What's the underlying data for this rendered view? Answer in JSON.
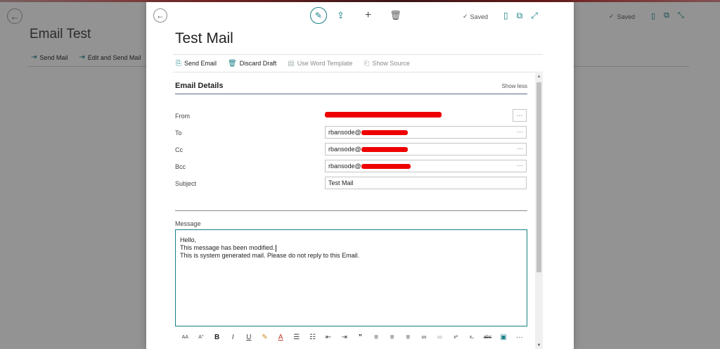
{
  "background": {
    "title": "Email Test",
    "actions": [
      {
        "icon": "send-icon",
        "label": "Send Mail"
      },
      {
        "icon": "send-icon",
        "label": "Edit and Send Mail"
      }
    ],
    "status": "Saved"
  },
  "dialog": {
    "title": "Test Mail",
    "status": "Saved",
    "top_icons": [
      "edit-icon",
      "share-icon",
      "add-icon",
      "delete-icon"
    ],
    "right_icons": [
      "bookmark-icon",
      "open-in-new-icon",
      "expand-icon"
    ],
    "actions": [
      {
        "icon": "send-email-icon",
        "label": "Send Email",
        "enabled": true
      },
      {
        "icon": "trash-icon",
        "label": "Discard Draft",
        "enabled": true
      },
      {
        "icon": "word-template-icon",
        "label": "Use Word Template",
        "enabled": false
      },
      {
        "icon": "source-icon",
        "label": "Show Source",
        "enabled": false
      }
    ],
    "section": {
      "title": "Email Details",
      "toggle": "Show less"
    },
    "fields": {
      "from": {
        "label": "From"
      },
      "to": {
        "label": "To",
        "value": "rbansode@"
      },
      "cc": {
        "label": "Cc",
        "value": "rbansode@"
      },
      "bcc": {
        "label": "Bcc",
        "value": "rbansode@"
      },
      "subject": {
        "label": "Subject",
        "value": "Test Mail"
      }
    },
    "message": {
      "label": "Message",
      "lines": [
        "Hello,",
        "This message has been modified.",
        "This is system generated mail. Please do not reply to this Email."
      ]
    },
    "toolbar": [
      "font-size-icon",
      "superscript-font-icon",
      "bold-icon",
      "italic-icon",
      "underline-icon",
      "highlight-icon",
      "font-color-icon",
      "bullets-icon",
      "numbering-icon",
      "outdent-icon",
      "indent-icon",
      "quote-icon",
      "align-left-icon",
      "align-center-icon",
      "align-right-icon",
      "link-icon",
      "unlink-icon",
      "superscript-icon",
      "subscript-icon",
      "strikethrough-icon",
      "image-icon",
      "more-icon"
    ]
  }
}
